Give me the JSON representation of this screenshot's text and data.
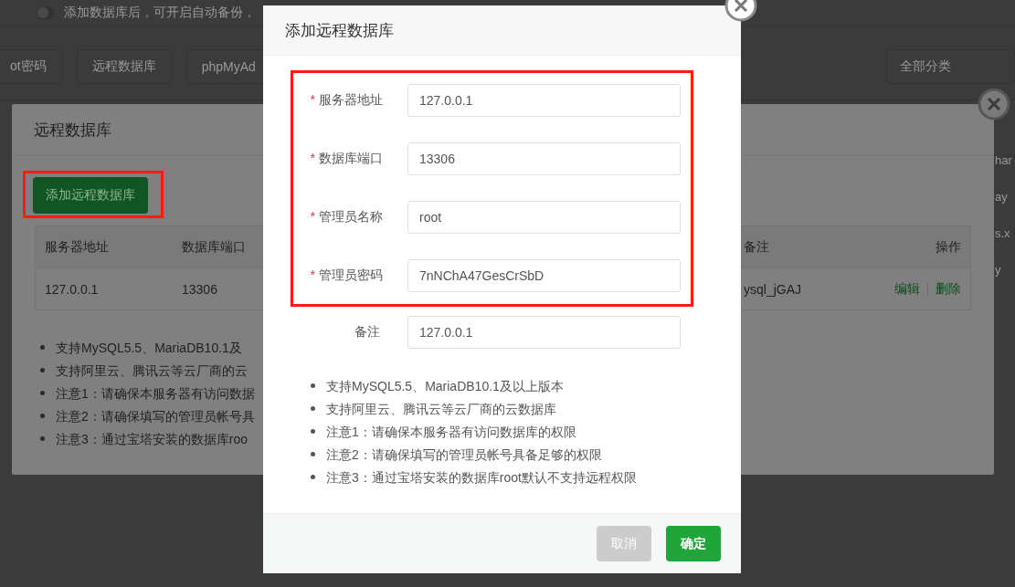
{
  "background_page": {
    "toggle": {
      "on": false
    },
    "hint": "添加数据库后，可开启自动备份，",
    "buttons": [
      "ot密码",
      "远程数据库",
      "phpMyAd"
    ],
    "category_select": "全部分类",
    "column_fragments": [
      "har",
      "ay",
      "s.x",
      "y"
    ]
  },
  "remote_dialog": {
    "title": "远程数据库",
    "highlight_frame": {
      "add_button": "添加远程数据库"
    },
    "table": {
      "columns": [
        "备注",
        "操作"
      ],
      "rows": [
        {
          "cells": [
            "ysql_jGAJ"
          ],
          "actions": [
            "编辑",
            "删除"
          ]
        }
      ],
      "left_columns": [
        "服务器地址",
        "数据库端口"
      ],
      "left_cells": [
        [
          "127.0.0.1",
          "13306"
        ]
      ]
    },
    "notes": [
      "支持MySQL5.5、MariaDB10.1及",
      "支持阿里云、腾讯云等云厂商的云",
      "注意1：请确保本服务器有访问数据",
      "注意2：请确保填写的管理员帐号具",
      "注意3：通过宝塔安装的数据库roo"
    ]
  },
  "add_dialog": {
    "title": "添加远程数据库",
    "highlight_frame": {
      "fields": [
        {
          "required_mark": "*",
          "label": "服务器地址",
          "value": "127.0.0.1"
        },
        {
          "required_mark": "*",
          "label": "数据库端口",
          "value": "13306"
        },
        {
          "required_mark": "*",
          "label": "管理员名称",
          "value": "root"
        },
        {
          "required_mark": "*",
          "label": "管理员密码",
          "value": "7nNChA47GesCrSbD"
        }
      ]
    },
    "fields": [
      {
        "label": "备注",
        "value": "127.0.0.1"
      }
    ],
    "notes": [
      "支持MySQL5.5、MariaDB10.1及以上版本",
      "支持阿里云、腾讯云等云厂商的云数据库",
      "注意1：请确保本服务器有访问数据库的权限",
      "注意2：请确保填写的管理员帐号具备足够的权限",
      "注意3：通过宝塔安装的数据库root默认不支持远程权限"
    ],
    "buttons": [
      {
        "label": "取消",
        "kind": "cancel"
      },
      {
        "label": "确定",
        "kind": "confirm"
      }
    ]
  }
}
